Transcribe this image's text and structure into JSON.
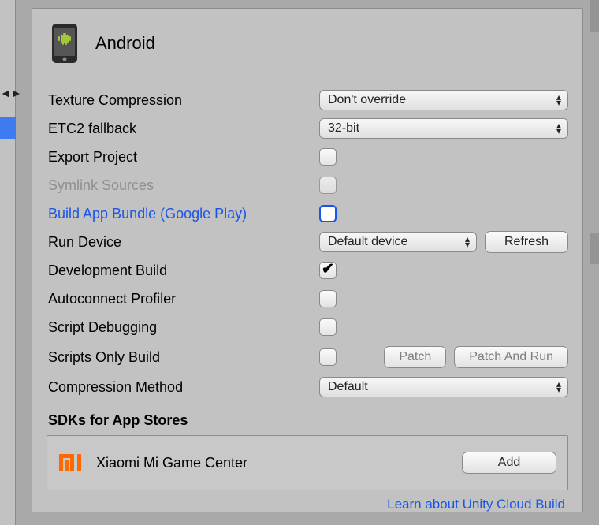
{
  "header": {
    "title": "Android"
  },
  "fields": {
    "texture_compression": {
      "label": "Texture Compression",
      "value": "Don't override"
    },
    "etc2_fallback": {
      "label": "ETC2 fallback",
      "value": "32-bit"
    },
    "export_project": {
      "label": "Export Project"
    },
    "symlink_sources": {
      "label": "Symlink Sources"
    },
    "build_app_bundle": {
      "label": "Build App Bundle (Google Play)"
    },
    "run_device": {
      "label": "Run Device",
      "value": "Default device",
      "refresh": "Refresh"
    },
    "development_build": {
      "label": "Development Build"
    },
    "autoconnect_profiler": {
      "label": "Autoconnect Profiler"
    },
    "script_debugging": {
      "label": "Script Debugging"
    },
    "scripts_only_build": {
      "label": "Scripts Only Build",
      "patch": "Patch",
      "patch_and_run": "Patch And Run"
    },
    "compression_method": {
      "label": "Compression Method",
      "value": "Default"
    }
  },
  "sdk_section": {
    "heading": "SDKs for App Stores",
    "item_label": "Xiaomi Mi Game Center",
    "add_button": "Add"
  },
  "footer": {
    "cloud_build_link": "Learn about Unity Cloud Build"
  }
}
